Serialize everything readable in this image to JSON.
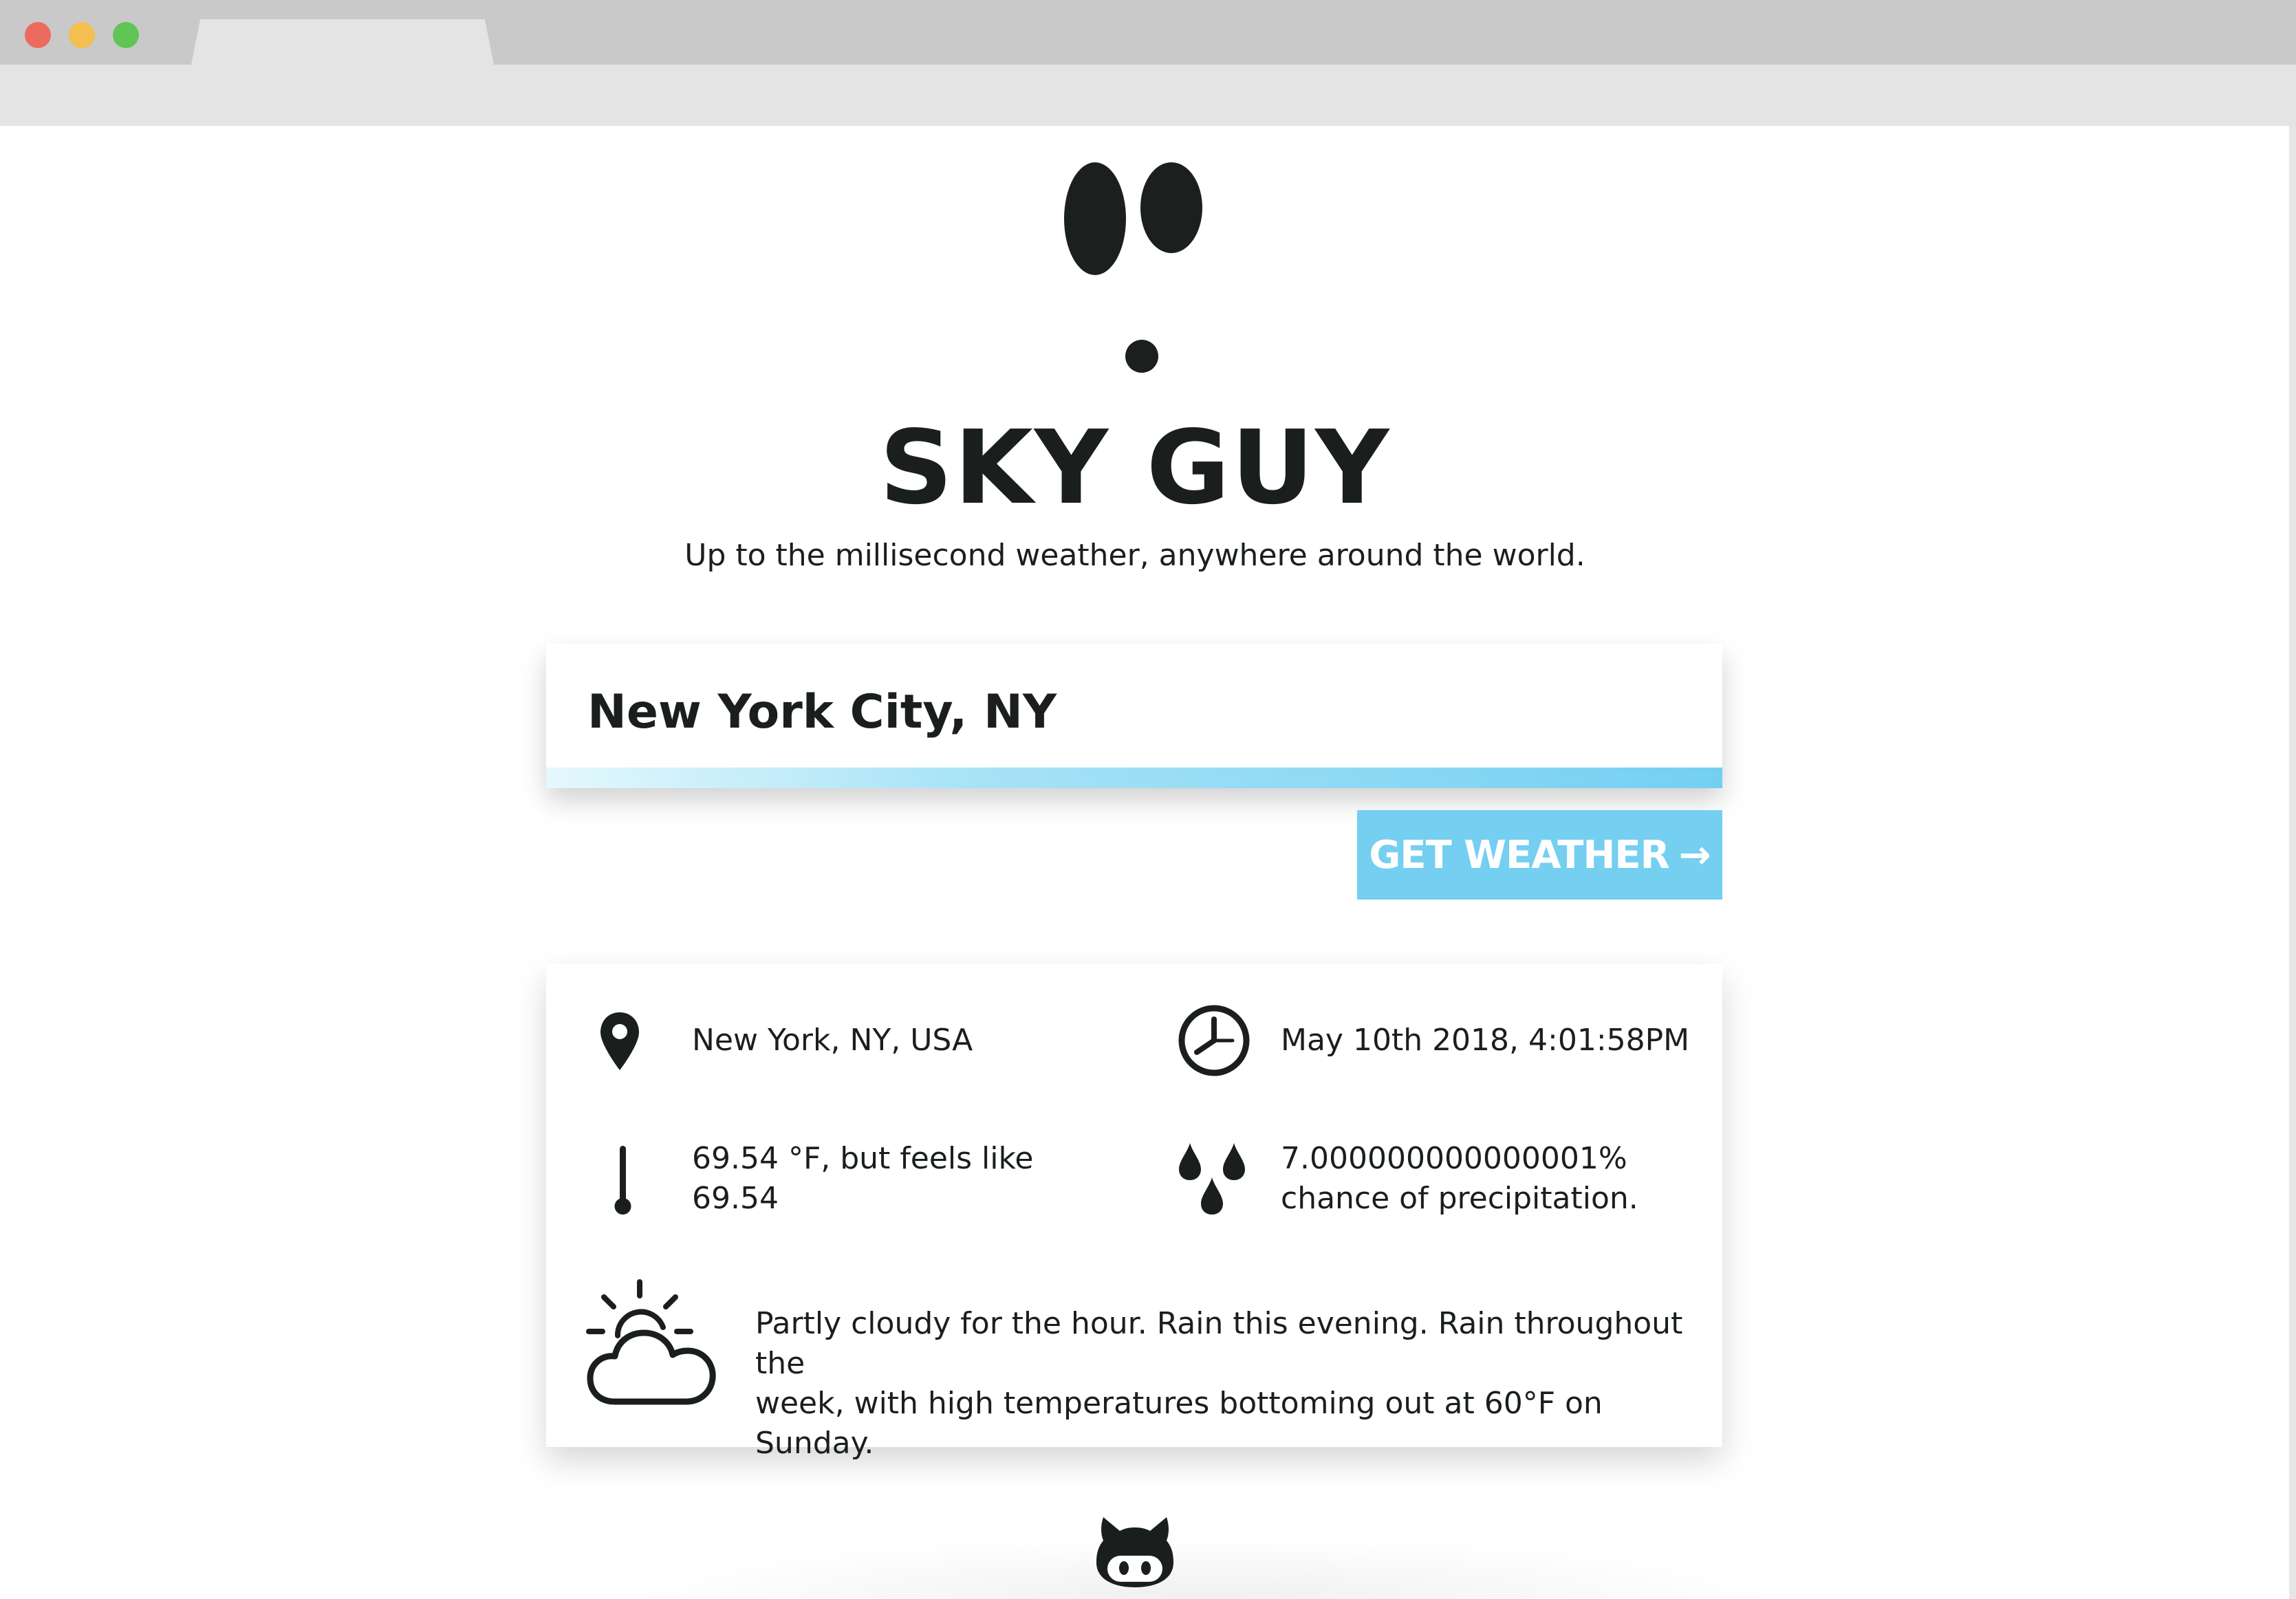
{
  "app": {
    "title": "SKY GUY",
    "subtitle": "Up to the millisecond weather, anywhere around the world."
  },
  "search": {
    "value": "New York City, NY",
    "button_label": "GET WEATHER",
    "button_arrow": "→"
  },
  "results": {
    "location": "New York, NY, USA",
    "datetime": "May 10th 2018, 4:01:58PM",
    "temperature_line1": "69.54 °F, but feels like",
    "temperature_line2": "69.54",
    "precip_line1": "7.000000000000001%",
    "precip_line2": "chance of precipitation.",
    "summary_line1": "Partly cloudy for the hour. Rain this evening. Rain throughout the",
    "summary_line2": "week, with high temperatures bottoming out at 60°F on Sunday."
  },
  "icons": {
    "location": "map-pin-icon",
    "time": "clock-icon",
    "temperature": "thermometer-icon",
    "precipitation": "raindrops-icon",
    "summary": "partly-cloudy-icon",
    "footer": "github-octocat-icon"
  },
  "colors": {
    "accent": "#74cff1",
    "text": "#1a1f1e",
    "gradient_start": "#e4f8fd"
  }
}
